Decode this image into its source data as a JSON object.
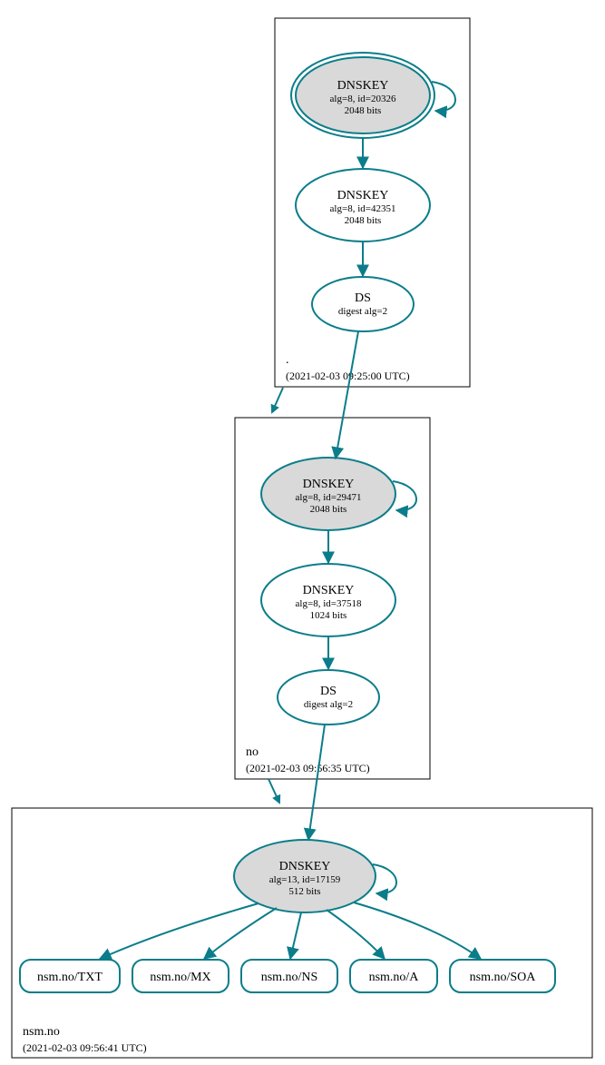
{
  "colors": {
    "teal": "#0B7D8A",
    "grey": "#d9d9d9",
    "white": "#ffffff",
    "black": "#000000"
  },
  "zones": {
    "root": {
      "label": ".",
      "time": "(2021-02-03 09:25:00 UTC)",
      "nodes": {
        "ksk": {
          "title": "DNSKEY",
          "line1": "alg=8, id=20326",
          "line2": "2048 bits"
        },
        "zsk": {
          "title": "DNSKEY",
          "line1": "alg=8, id=42351",
          "line2": "2048 bits"
        },
        "ds": {
          "title": "DS",
          "line1": "digest alg=2"
        }
      }
    },
    "no": {
      "label": "no",
      "time": "(2021-02-03 09:56:35 UTC)",
      "nodes": {
        "ksk": {
          "title": "DNSKEY",
          "line1": "alg=8, id=29471",
          "line2": "2048 bits"
        },
        "zsk": {
          "title": "DNSKEY",
          "line1": "alg=8, id=37518",
          "line2": "1024 bits"
        },
        "ds": {
          "title": "DS",
          "line1": "digest alg=2"
        }
      }
    },
    "nsm": {
      "label": "nsm.no",
      "time": "(2021-02-03 09:56:41 UTC)",
      "nodes": {
        "ksk": {
          "title": "DNSKEY",
          "line1": "alg=13, id=17159",
          "line2": "512 bits"
        }
      },
      "records": {
        "txt": "nsm.no/TXT",
        "mx": "nsm.no/MX",
        "ns": "nsm.no/NS",
        "a": "nsm.no/A",
        "soa": "nsm.no/SOA"
      }
    }
  }
}
